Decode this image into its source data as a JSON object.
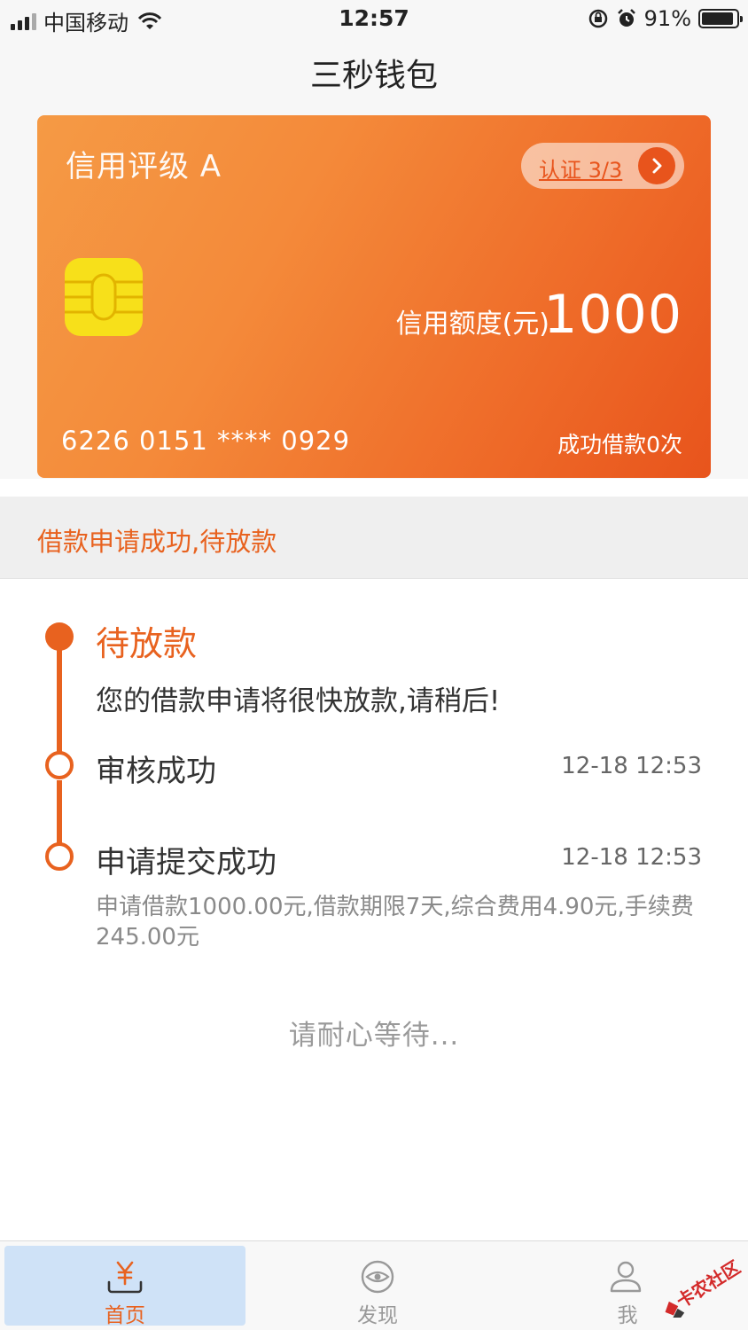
{
  "status_bar": {
    "carrier": "中国移动",
    "time": "12:57",
    "battery": "91%",
    "battery_level": 0.91
  },
  "nav": {
    "title": "三秒钱包"
  },
  "card": {
    "rating": "信用评级 A",
    "certification": "认证 3/3",
    "limit_label": "信用额度(元)",
    "limit_value": "1000",
    "card_number": "6226 0151 **** 0929",
    "loan_count": "成功借款0次",
    "colors": {
      "start": "#f59a45",
      "end": "#e8541c",
      "chip": "#f7e01a"
    }
  },
  "banner": {
    "text": "借款申请成功,待放款"
  },
  "timeline": {
    "accent": "#e8621f",
    "steps": [
      {
        "title": "待放款",
        "desc": "您的借款申请将很快放款,请稍后!",
        "active": true
      },
      {
        "title": "审核成功",
        "time": "12-18 12:53"
      },
      {
        "title": "申请提交成功",
        "time": "12-18 12:53",
        "detail": "申请借款1000.00元,借款期限7天,综合费用4.90元,手续费245.00元"
      }
    ]
  },
  "waiting_text": "请耐心等待...",
  "tabs": [
    {
      "label": "首页",
      "icon": "yen-tray-icon",
      "selected": true
    },
    {
      "label": "发现",
      "icon": "eye-icon",
      "selected": false
    },
    {
      "label": "我",
      "icon": "user-icon",
      "selected": false
    }
  ],
  "watermark": {
    "text": "卡农社区"
  }
}
